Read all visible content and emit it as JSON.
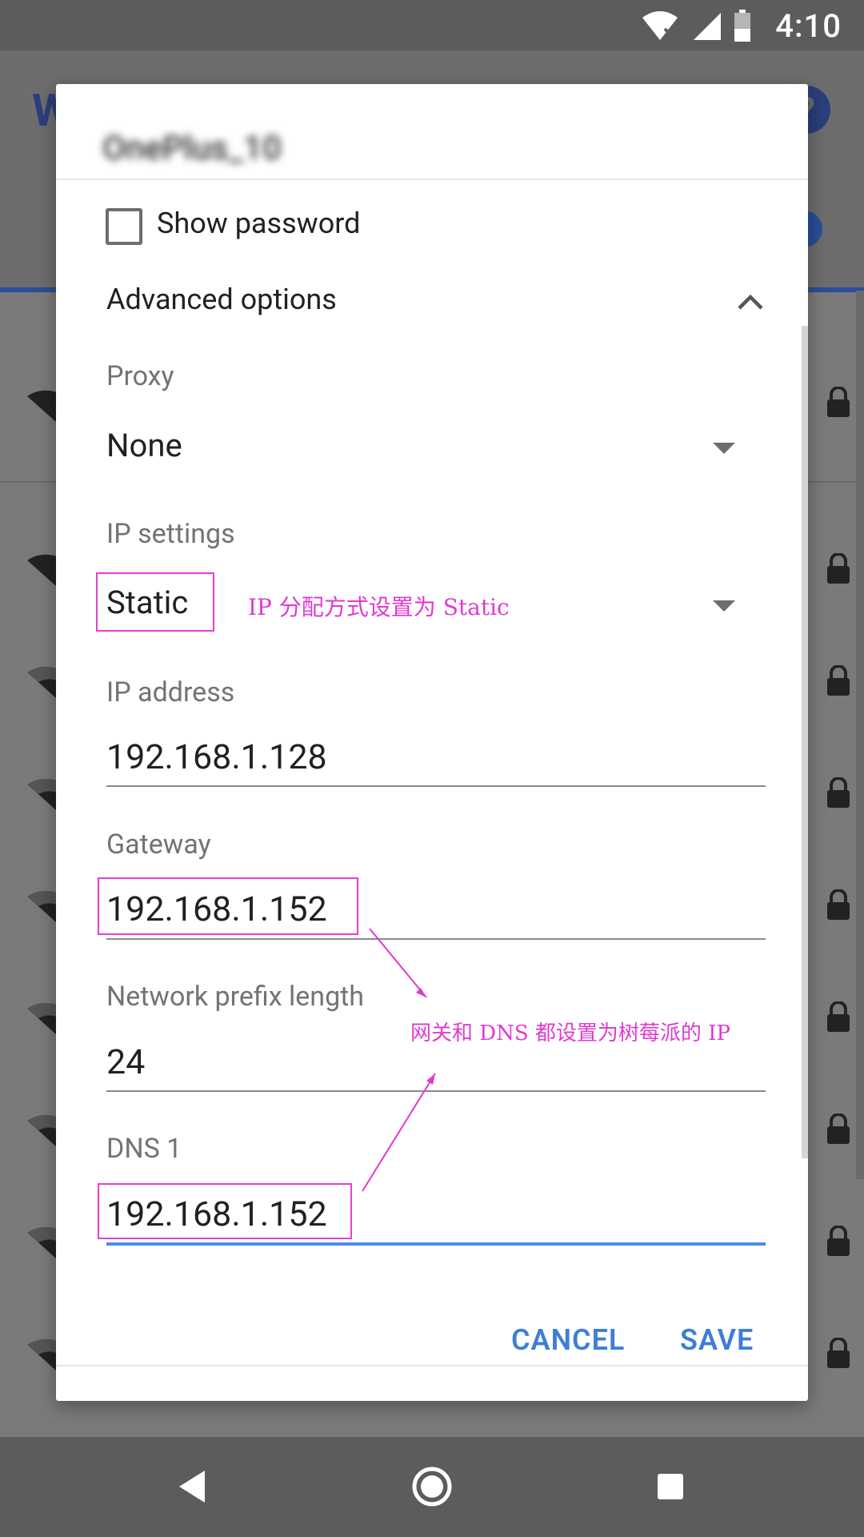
{
  "status_bar": {
    "time": "4:10"
  },
  "background": {
    "title_initial": "W",
    "help_glyph": "?"
  },
  "dialog": {
    "network_name": "OnePlus_10",
    "show_password_label": "Show password",
    "advanced_options_label": "Advanced options",
    "proxy": {
      "label": "Proxy",
      "value": "None"
    },
    "ip_settings": {
      "label": "IP settings",
      "value": "Static"
    },
    "ip_address": {
      "label": "IP address",
      "value": "192.168.1.128"
    },
    "gateway": {
      "label": "Gateway",
      "value": "192.168.1.152"
    },
    "prefix_length": {
      "label": "Network prefix length",
      "value": "24"
    },
    "dns1": {
      "label": "DNS 1",
      "value": "192.168.1.152"
    },
    "buttons": {
      "cancel": "CANCEL",
      "save": "SAVE"
    }
  },
  "annotations": {
    "ip_mode_note": "IP 分配方式设置为 Static",
    "gateway_dns_note": "网关和 DNS 都设置为树莓派的 IP"
  },
  "colors": {
    "accent": "#3f7ed8",
    "annotation": "#e03ad0",
    "active_field": "#4a8de8"
  },
  "icons": [
    "wifi-icon",
    "signal-icon",
    "battery-icon",
    "chevron-up-icon",
    "dropdown-caret-icon",
    "lock-icon",
    "back-icon",
    "home-icon",
    "recents-icon"
  ]
}
